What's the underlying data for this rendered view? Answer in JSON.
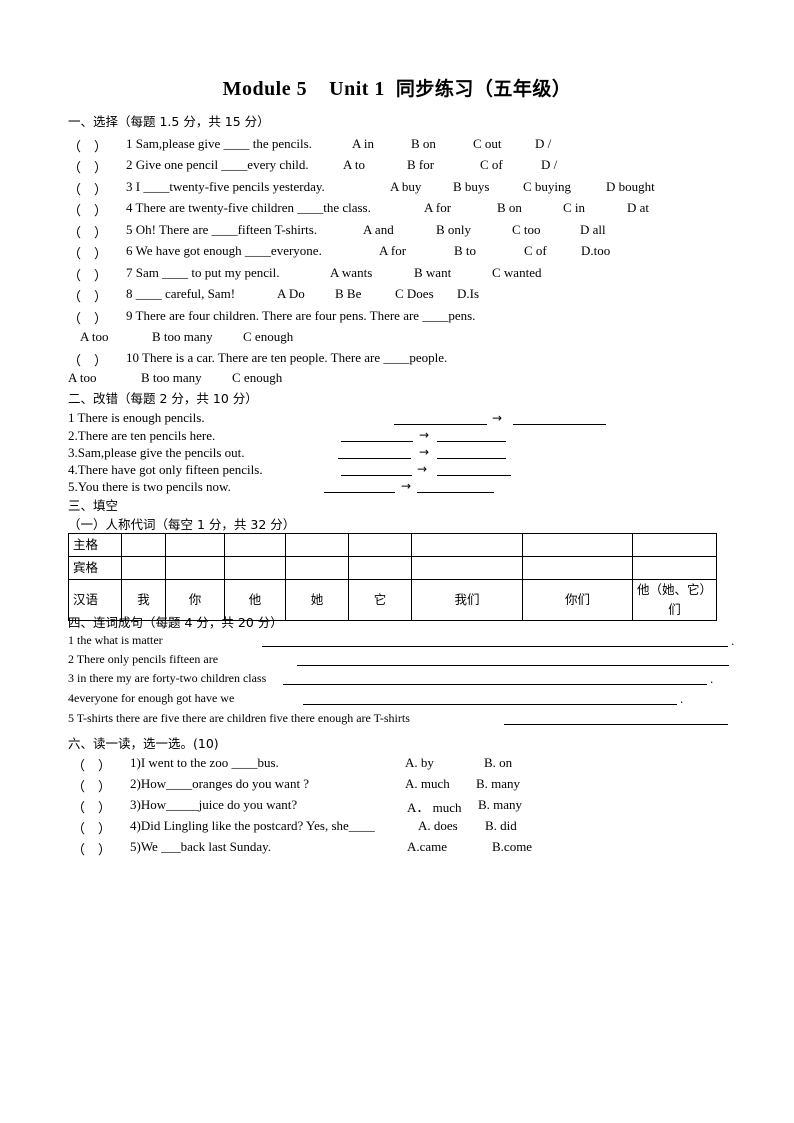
{
  "title": {
    "module": "Module 5",
    "unit": "Unit 1",
    "chinese": "同步练习（五年级）"
  },
  "section1": {
    "heading": "一、选择（每题 1.5 分，共 15 分）",
    "questions": [
      {
        "num": "1",
        "text": "1 Sam,please give ____ the pencils.",
        "options": [
          "A in",
          "B on",
          "C out",
          "D /"
        ]
      },
      {
        "num": "2",
        "text": "2 Give one pencil ____every child.",
        "options": [
          "A to",
          "B for",
          "C of",
          "D /"
        ]
      },
      {
        "num": "3",
        "text": "3 I ____twenty-five pencils yesterday.",
        "options": [
          "A buy",
          "B buys",
          "C buying",
          "D bought"
        ]
      },
      {
        "num": "4",
        "text": "4 There are twenty-five children ____the class.",
        "options": [
          "A for",
          "B on",
          "C in",
          "D at"
        ]
      },
      {
        "num": "5",
        "text": "5 Oh! There are ____fifteen T-shirts.",
        "options": [
          "A and",
          "B only",
          "C too",
          "D all"
        ]
      },
      {
        "num": "6",
        "text": "6 We have got enough ____everyone.",
        "options": [
          "A for",
          "B to",
          "C of",
          "D.too"
        ]
      },
      {
        "num": "7",
        "text": "7 Sam ____ to put my pencil.",
        "options": [
          "A wants",
          "B want",
          "C wanted"
        ]
      },
      {
        "num": "8",
        "text": "8 ____ careful, Sam!",
        "options": [
          "A Do",
          "B Be",
          "C Does",
          "D.Is"
        ]
      },
      {
        "num": "9",
        "text": "9 There are four children. There are four pens. There are ____pens.",
        "options": [
          "A too",
          "B too many",
          "C enough"
        ]
      },
      {
        "num": "10",
        "text": "10 There is a car. There are ten people. There are ____people.",
        "options": [
          "A too",
          "B too many",
          "C enough"
        ]
      }
    ]
  },
  "section2": {
    "heading": "二、改错（每题 2 分，共 10 分）",
    "items": [
      "1  There is enough    pencils.",
      "2.There are ten pencils here.",
      "3.Sam,please give the pencils out.",
      "4.There have got only fifteen pencils.",
      "5.You there is two pencils now.",
      "→"
    ]
  },
  "section3": {
    "heading": "三、填空",
    "subheading": "（一）人称代词（每空 1 分，共 32 分）",
    "table": {
      "rows": [
        {
          "label": "主格",
          "cells": [
            "",
            "",
            "",
            "",
            "",
            "",
            "",
            ""
          ]
        },
        {
          "label": "宾格",
          "cells": [
            "",
            "",
            "",
            "",
            "",
            "",
            "",
            ""
          ]
        },
        {
          "label": "汉语",
          "cells": [
            "我",
            "你",
            "他",
            "她",
            "它",
            "我们",
            "你们",
            "他（她、它）们"
          ]
        }
      ]
    }
  },
  "section4": {
    "heading": "四、连词成句（每题 4 分，共 20 分）",
    "items": [
      "1 the    what    is    matter",
      "2 There    only    pencils fifteen are",
      "3 in there my are forty-two children class",
      "4everyone for    enough got have    we",
      "5 T-shirts there are five there are children five there enough are T-shirts"
    ],
    "period": "."
  },
  "section6": {
    "heading": "六、读一读，选一选。(10)",
    "questions": [
      {
        "text": "1)I went to the zoo  ____bus.",
        "options": [
          "A. by",
          "B. on"
        ]
      },
      {
        "text": "2)How____oranges do you want ?",
        "options": [
          "A. much",
          "B. many"
        ]
      },
      {
        "text": "3)How_____juice do you want?",
        "options": [
          "A． much",
          "B. many"
        ]
      },
      {
        "text": "4)Did Lingling like the postcard? Yes, she____",
        "options": [
          "A. does",
          "B. did"
        ]
      },
      {
        "text": "5)We ___back last Sunday.",
        "options": [
          "A.came",
          "B.come"
        ]
      }
    ]
  },
  "misc": {
    "open_paren": "(",
    "close_paren": ")"
  }
}
